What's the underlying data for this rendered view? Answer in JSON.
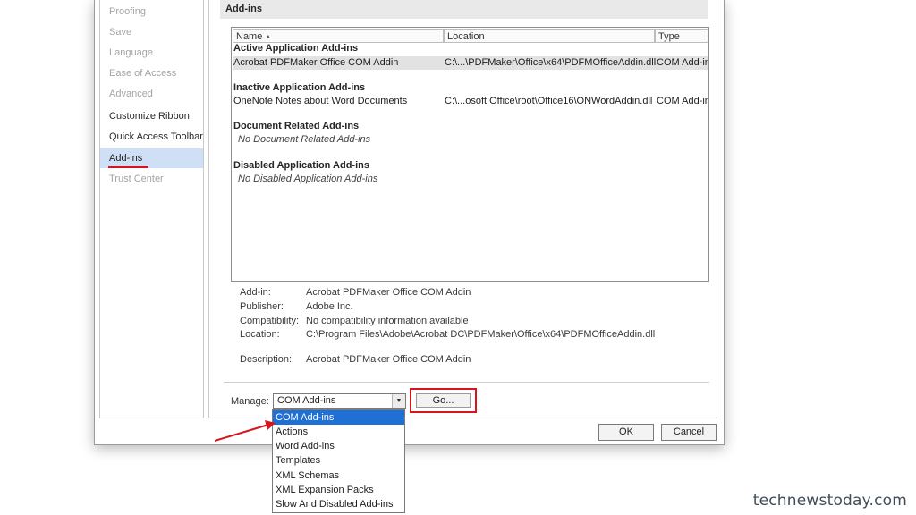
{
  "sidebar": {
    "items": [
      {
        "label": "Proofing",
        "state": "dim"
      },
      {
        "label": "Save",
        "state": "dim"
      },
      {
        "label": "Language",
        "state": "dim"
      },
      {
        "label": "Ease of Access",
        "state": "dim"
      },
      {
        "label": "Advanced",
        "state": "dim"
      },
      {
        "label": "Customize Ribbon",
        "state": "normal"
      },
      {
        "label": "Quick Access Toolbar",
        "state": "normal"
      },
      {
        "label": "Add-ins",
        "state": "selected"
      },
      {
        "label": "Trust Center",
        "state": "dim"
      }
    ]
  },
  "main": {
    "section_title": "Add-ins",
    "columns": {
      "name": "Name",
      "location": "Location",
      "type": "Type"
    },
    "groups": {
      "active": {
        "title": "Active Application Add-ins",
        "rows": [
          {
            "name": "Acrobat PDFMaker Office COM Addin",
            "location": "C:\\...\\PDFMaker\\Office\\x64\\PDFMOfficeAddin.dll",
            "type": "COM Add-in"
          }
        ]
      },
      "inactive": {
        "title": "Inactive Application Add-ins",
        "rows": [
          {
            "name": "OneNote Notes about Word Documents",
            "location": "C:\\...osoft Office\\root\\Office16\\ONWordAddin.dll",
            "type": "COM Add-in"
          }
        ]
      },
      "document": {
        "title": "Document Related Add-ins",
        "empty": "No Document Related Add-ins"
      },
      "disabled": {
        "title": "Disabled Application Add-ins",
        "empty": "No Disabled Application Add-ins"
      }
    },
    "details": {
      "addin_label": "Add-in:",
      "addin_value": "Acrobat PDFMaker Office COM Addin",
      "publisher_label": "Publisher:",
      "publisher_value": "Adobe Inc.",
      "compat_label": "Compatibility:",
      "compat_value": "No compatibility information available",
      "location_label": "Location:",
      "location_value": "C:\\Program Files\\Adobe\\Acrobat DC\\PDFMaker\\Office\\x64\\PDFMOfficeAddin.dll",
      "description_label": "Description:",
      "description_value": "Acrobat PDFMaker Office COM Addin"
    },
    "manage": {
      "label": "Manage:",
      "selected": "COM Add-ins",
      "go_label": "Go...",
      "options": [
        "COM Add-ins",
        "Actions",
        "Word Add-ins",
        "Templates",
        "XML Schemas",
        "XML Expansion Packs",
        "Slow And Disabled Add-ins"
      ]
    }
  },
  "footer": {
    "ok_label": "OK",
    "cancel_label": "Cancel"
  },
  "watermark": "technewstoday.com",
  "colors": {
    "annotation_red": "#d6151c",
    "selection_blue": "#1f6fd4",
    "nav_selected": "#cfe0f6"
  }
}
